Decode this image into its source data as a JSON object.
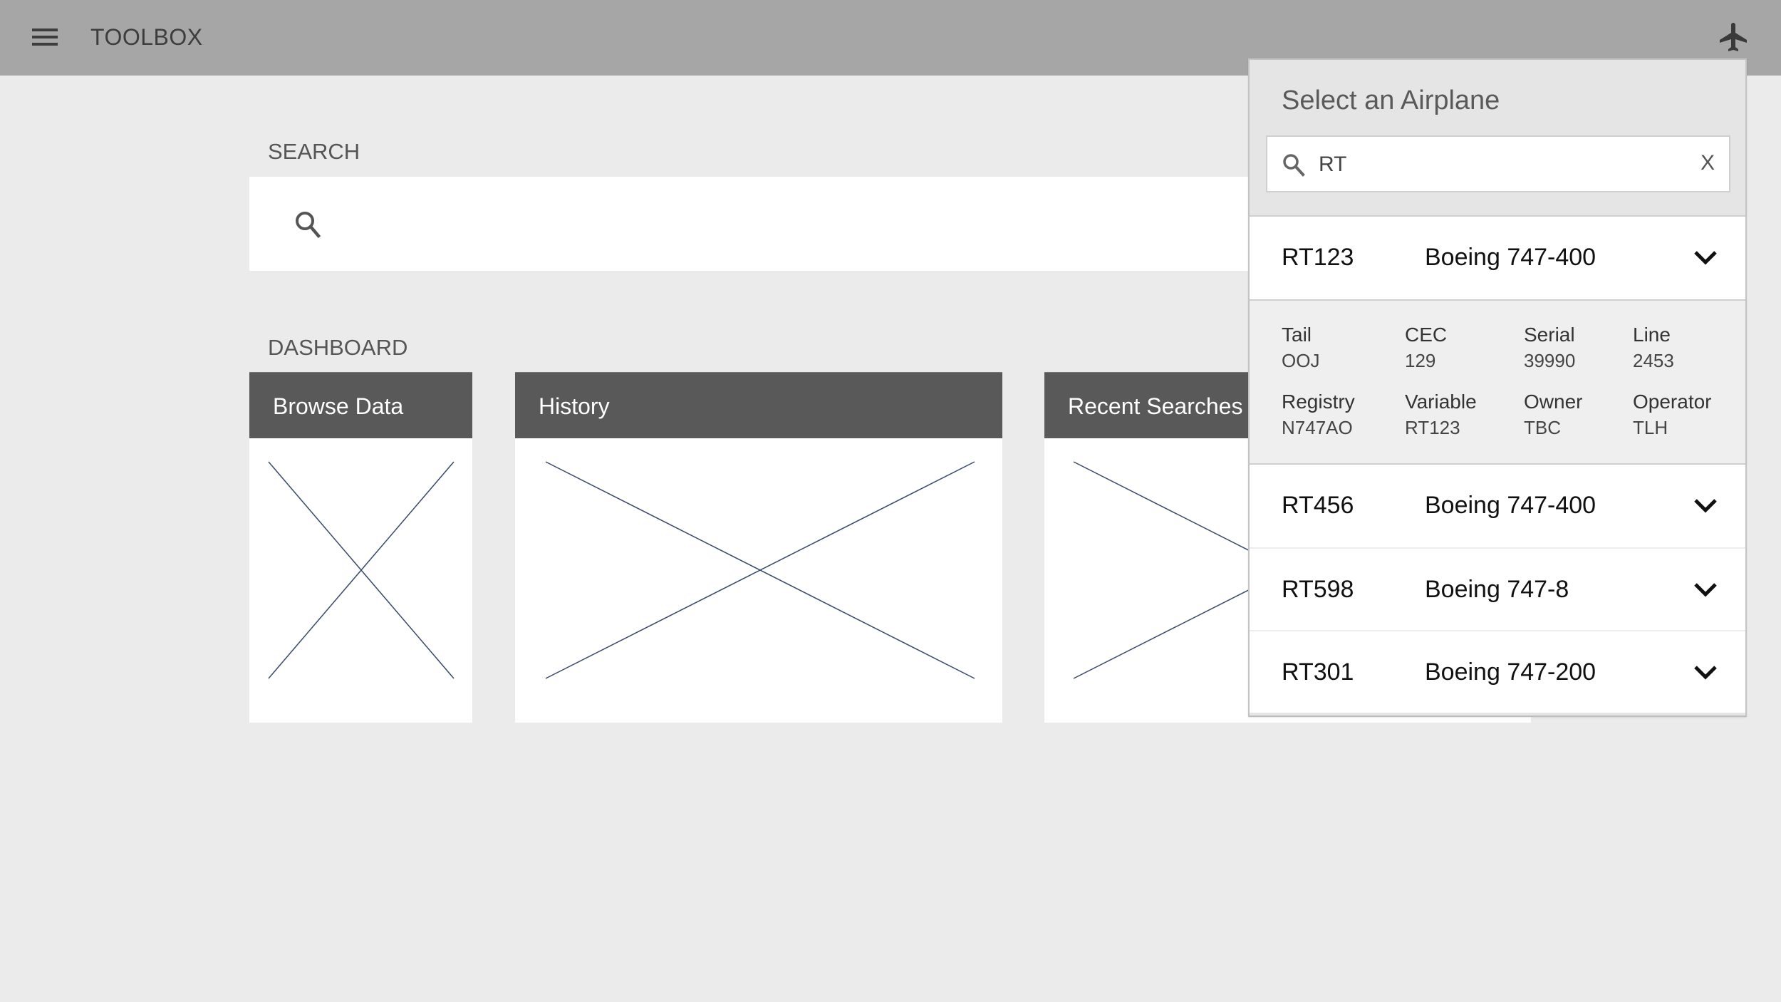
{
  "header": {
    "app_title": "TOOLBOX",
    "menu_icon": "hamburger-menu-icon",
    "airplane_icon": "airplane-icon"
  },
  "search": {
    "label": "SEARCH",
    "value": "",
    "placeholder": "",
    "icon": "search-icon"
  },
  "dashboard": {
    "label": "DASHBOARD",
    "cards": [
      {
        "title": "Browse Data"
      },
      {
        "title": "History"
      },
      {
        "title": "Recent Searches"
      }
    ]
  },
  "airplane_selector": {
    "title": "Select an Airplane",
    "search_value": "RT",
    "clear_label": "X",
    "results": [
      {
        "id": "RT123",
        "model": "Boeing 747-400",
        "expanded": true
      },
      {
        "id": "RT456",
        "model": "Boeing 747-400",
        "expanded": false
      },
      {
        "id": "RT598",
        "model": "Boeing 747-8",
        "expanded": false
      },
      {
        "id": "RT301",
        "model": "Boeing 747-200",
        "expanded": false
      }
    ],
    "details": [
      {
        "label": "Tail",
        "value": "OOJ"
      },
      {
        "label": "CEC",
        "value": "129"
      },
      {
        "label": "Serial",
        "value": "39990"
      },
      {
        "label": "Line",
        "value": "2453"
      },
      {
        "label": "Registry",
        "value": "N747AO"
      },
      {
        "label": "Variable",
        "value": "RT123"
      },
      {
        "label": "Owner",
        "value": "TBC"
      },
      {
        "label": "Operator",
        "value": "TLH"
      }
    ]
  },
  "colors": {
    "topbar": "#a6a6a6",
    "background": "#ebebeb",
    "card_header": "#595959",
    "placeholder_line": "#3a4a6b"
  }
}
